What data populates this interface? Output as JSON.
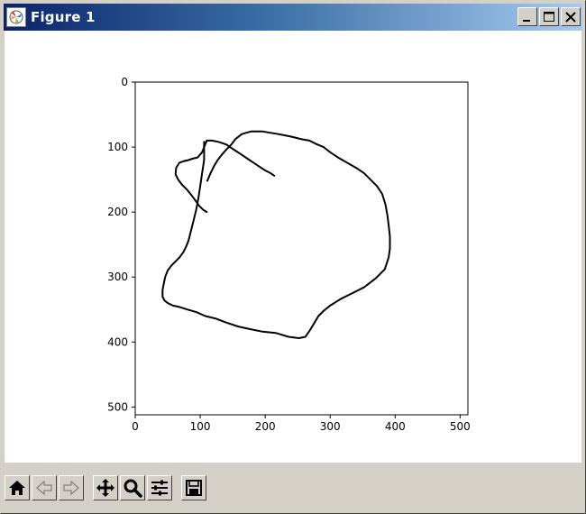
{
  "window": {
    "title": "Figure 1",
    "buttons": [
      "minimize-icon",
      "maximize-icon",
      "close-icon"
    ]
  },
  "toolbar": {
    "tools": [
      "home-icon",
      "back-icon",
      "forward-icon",
      "pan-icon",
      "zoom-icon",
      "configure-subplots-icon",
      "save-icon"
    ]
  },
  "chart_data": {
    "type": "line",
    "title": "",
    "xlabel": "",
    "ylabel": "",
    "xlim": [
      0,
      512
    ],
    "ylim": [
      512,
      0
    ],
    "y_inverted": true,
    "x_ticks": [
      "0",
      "100",
      "200",
      "300",
      "400",
      "500"
    ],
    "y_ticks": [
      "0",
      "100",
      "200",
      "300",
      "400",
      "500"
    ],
    "grid": false,
    "line_color": "#000000",
    "series": [
      {
        "x": [
          110,
          104,
          98,
          94,
          88,
          80,
          72,
          66,
          62,
          63,
          68,
          74,
          82,
          88,
          96,
          103,
          110,
          118,
          128,
          140,
          152,
          164,
          176,
          188,
          200,
          208,
          214
        ],
        "y": [
          200,
          196,
          190,
          184,
          176,
          166,
          158,
          150,
          142,
          132,
          124,
          122,
          120,
          118,
          116,
          108,
          90,
          90,
          92,
          96,
          104,
          112,
          120,
          128,
          136,
          140,
          144
        ]
      },
      {
        "x": [
          106,
          106,
          103,
          100,
          97,
          94,
          90,
          86,
          82,
          78,
          74,
          68,
          62,
          56,
          50,
          46,
          44,
          42,
          42,
          45,
          50,
          58,
          68,
          80,
          94,
          108,
          124,
          140,
          158,
          176,
          196,
          216,
          236,
          252,
          262,
          270,
          276,
          282,
          290,
          300,
          316,
          332,
          352,
          370,
          384,
          390,
          392,
          392,
          390,
          388,
          385,
          380,
          372,
          362,
          352,
          340,
          326,
          312,
          300,
          290,
          280,
          268,
          256,
          240,
          220,
          196,
          178,
          164,
          154,
          148,
          140,
          133,
          127,
          122,
          116,
          111
        ],
        "y": [
          92,
          120,
          140,
          160,
          180,
          196,
          212,
          228,
          244,
          254,
          262,
          270,
          276,
          282,
          290,
          300,
          310,
          320,
          330,
          336,
          340,
          344,
          346,
          350,
          354,
          360,
          364,
          370,
          376,
          380,
          384,
          386,
          392,
          394,
          392,
          380,
          370,
          360,
          352,
          344,
          334,
          326,
          316,
          302,
          288,
          270,
          256,
          238,
          220,
          204,
          188,
          172,
          160,
          150,
          140,
          132,
          124,
          116,
          108,
          100,
          96,
          90,
          88,
          84,
          80,
          76,
          76,
          80,
          88,
          96,
          104,
          112,
          120,
          128,
          140,
          152
        ]
      }
    ]
  }
}
